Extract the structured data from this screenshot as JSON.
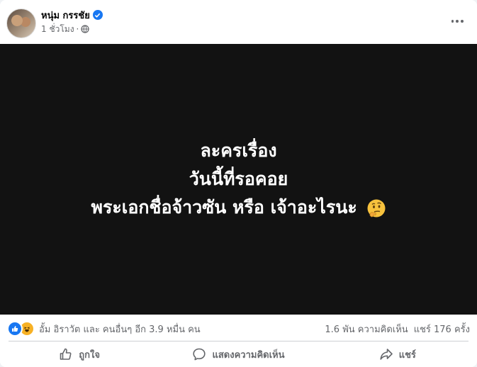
{
  "post": {
    "author": "หนุ่ม กรรชัย",
    "timestamp": "1 ชั่วโมง",
    "separator": "·",
    "audience_icon": "globe-icon",
    "verified_icon": "verified-badge-icon",
    "lines": [
      "ละครเรื่อง",
      "วันนี้ที่รอคอย",
      "พระเอกชื่อจ้าวซัน หรือ เจ้าอะไรนะ"
    ],
    "emoji": "thinking-face"
  },
  "stats": {
    "reaction_icons": [
      "like-icon",
      "haha-icon"
    ],
    "reaction_text": "อั้ม อิราวัต และ คนอื่นๆ อีก 3.9 หมื่น คน",
    "comments": "1.6 พัน ความคิดเห็น",
    "shares": "แชร์ 176 ครั้ง"
  },
  "actions": {
    "like": "ถูกใจ",
    "comment": "แสดงความคิดเห็น",
    "share": "แชร์"
  },
  "colors": {
    "accent": "#1877f2",
    "secondary_text": "#65676b",
    "image_bg": "#121212"
  }
}
